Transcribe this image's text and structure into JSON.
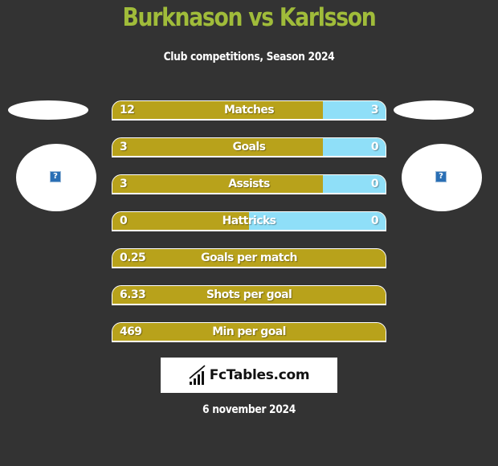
{
  "header": {
    "title": "Burknason vs Karlsson",
    "subtitle": "Club competitions, Season 2024"
  },
  "players": {
    "left": {
      "name": "Burknason",
      "avatar_icon": "missing-image-icon",
      "avatar_glyph": "?"
    },
    "right": {
      "name": "Karlsson",
      "avatar_icon": "missing-image-icon",
      "avatar_glyph": "?"
    }
  },
  "colors": {
    "background": "#333333",
    "title": "#a0bc3a",
    "left_bar": "#b8a21b",
    "right_bar": "#8fdff8",
    "text": "#ffffff"
  },
  "stats": [
    {
      "label": "Matches",
      "left": "12",
      "right": "3",
      "left_share": 0.77
    },
    {
      "label": "Goals",
      "left": "3",
      "right": "0",
      "left_share": 0.77
    },
    {
      "label": "Assists",
      "left": "3",
      "right": "0",
      "left_share": 0.77
    },
    {
      "label": "Hattricks",
      "left": "0",
      "right": "0",
      "left_share": 0.5
    },
    {
      "label": "Goals per match",
      "left": "0.25",
      "right": "",
      "left_share": 1.0
    },
    {
      "label": "Shots per goal",
      "left": "6.33",
      "right": "",
      "left_share": 1.0
    },
    {
      "label": "Min per goal",
      "left": "469",
      "right": "",
      "left_share": 1.0
    }
  ],
  "footer": {
    "logo_text": "FcTables.com",
    "logo_icon": "bar-chart-trend-icon",
    "date": "6 november 2024"
  }
}
